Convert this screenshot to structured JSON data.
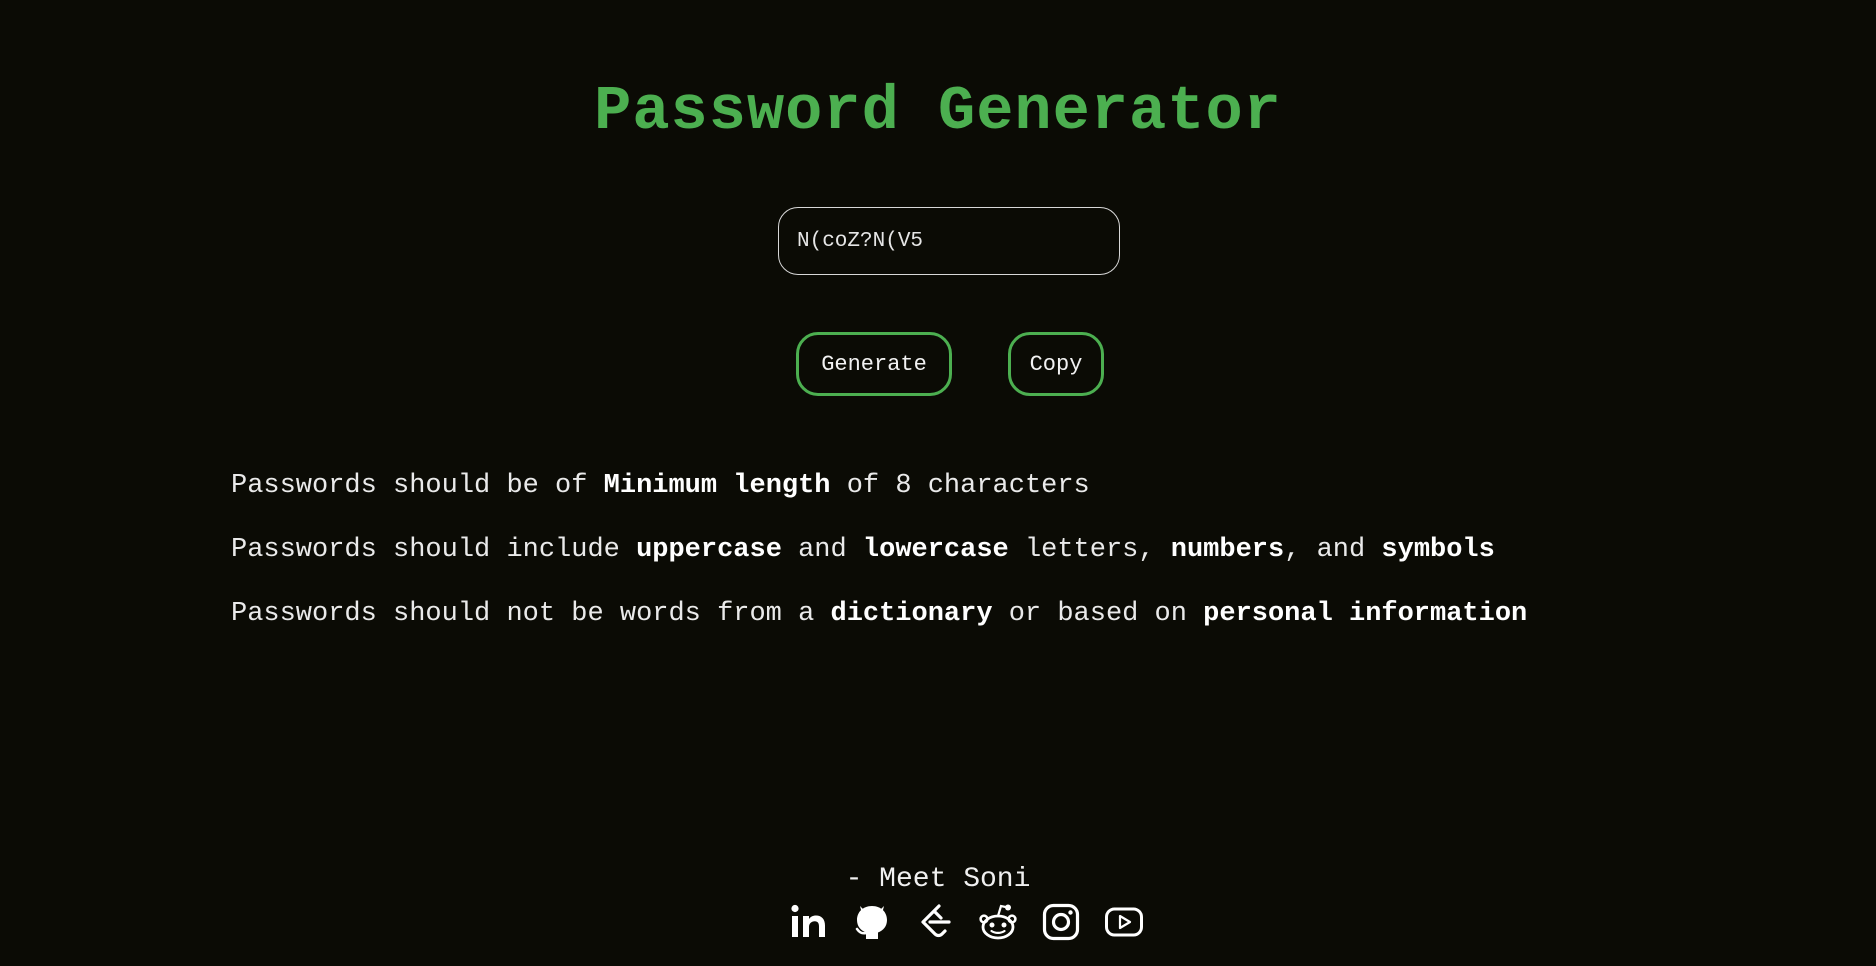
{
  "page": {
    "title": "Password Generator"
  },
  "generator": {
    "password_value": "N(coZ?N(V5",
    "generate_label": "Generate",
    "copy_label": "Copy"
  },
  "rules": [
    {
      "parts": [
        {
          "text": "Passwords should be of ",
          "bold": false
        },
        {
          "text": "Minimum length",
          "bold": true
        },
        {
          "text": " of 8 characters",
          "bold": false
        }
      ]
    },
    {
      "parts": [
        {
          "text": "Passwords should include ",
          "bold": false
        },
        {
          "text": "uppercase",
          "bold": true
        },
        {
          "text": " and ",
          "bold": false
        },
        {
          "text": "lowercase",
          "bold": true
        },
        {
          "text": " letters, ",
          "bold": false
        },
        {
          "text": "numbers",
          "bold": true
        },
        {
          "text": ", and ",
          "bold": false
        },
        {
          "text": "symbols",
          "bold": true
        }
      ]
    },
    {
      "parts": [
        {
          "text": "Passwords should not be words from a ",
          "bold": false
        },
        {
          "text": "dictionary",
          "bold": true
        },
        {
          "text": " or based on ",
          "bold": false
        },
        {
          "text": "personal information",
          "bold": true
        }
      ]
    }
  ],
  "footer": {
    "credit": "- Meet Soni",
    "socials": [
      {
        "icon": "linkedin-icon"
      },
      {
        "icon": "github-icon"
      },
      {
        "icon": "leetcode-icon"
      },
      {
        "icon": "reddit-icon"
      },
      {
        "icon": "instagram-icon"
      },
      {
        "icon": "youtube-icon"
      }
    ]
  },
  "colors": {
    "background": "#0b0b05",
    "accent": "#4caf50",
    "text": "#ececec"
  }
}
